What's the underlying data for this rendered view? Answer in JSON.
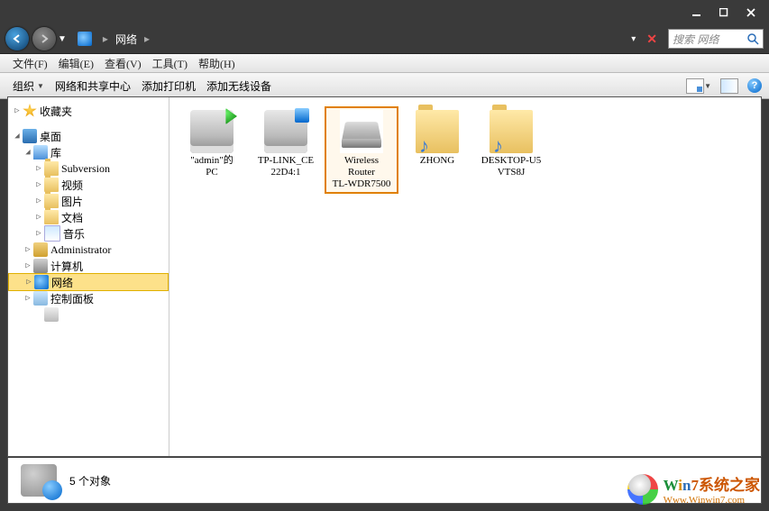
{
  "titlebar": {
    "min": "–",
    "max": "□",
    "close": "×"
  },
  "nav": {
    "location": "网络",
    "refresh_dd": "▾",
    "close_x": "✕"
  },
  "search": {
    "placeholder": "搜索 网络"
  },
  "menubar": [
    {
      "label": "文件(F)"
    },
    {
      "label": "编辑(E)"
    },
    {
      "label": "查看(V)"
    },
    {
      "label": "工具(T)"
    },
    {
      "label": "帮助(H)"
    }
  ],
  "toolbar": {
    "organize": "组织",
    "network_center": "网络和共享中心",
    "add_printer": "添加打印机",
    "add_wireless": "添加无线设备"
  },
  "tree": {
    "favorites": "收藏夹",
    "desktop": "桌面",
    "library": "库",
    "items": [
      {
        "label": "Subversion",
        "icon": "fold"
      },
      {
        "label": "视频",
        "icon": "fold"
      },
      {
        "label": "图片",
        "icon": "fold"
      },
      {
        "label": "文档",
        "icon": "fold"
      },
      {
        "label": "音乐",
        "icon": "music"
      }
    ],
    "admin": "Administrator",
    "computer": "计算机",
    "network": "网络",
    "control": "控制面板",
    "recycle": ""
  },
  "content": [
    {
      "label1": "\"admin\"的",
      "label2": "PC",
      "icon": "pc",
      "sel": false
    },
    {
      "label1": "TP-LINK_CE",
      "label2": "22D4:1",
      "icon": "pc2",
      "sel": false
    },
    {
      "label1": "Wireless",
      "label2": "Router",
      "label3": "TL-WDR7500",
      "icon": "router",
      "sel": true
    },
    {
      "label1": "ZHONG",
      "label2": "",
      "icon": "mfold",
      "sel": false
    },
    {
      "label1": "DESKTOP-U5",
      "label2": "VTS8J",
      "icon": "mfold",
      "sel": false
    }
  ],
  "status": {
    "text": "5 个对象"
  },
  "watermark": {
    "brand_w": "W",
    "brand_i": "i",
    "brand_n": "n",
    "brand_7": "7",
    "brand_rest": "系统之家",
    "url": "Www.Winwin7.com"
  }
}
